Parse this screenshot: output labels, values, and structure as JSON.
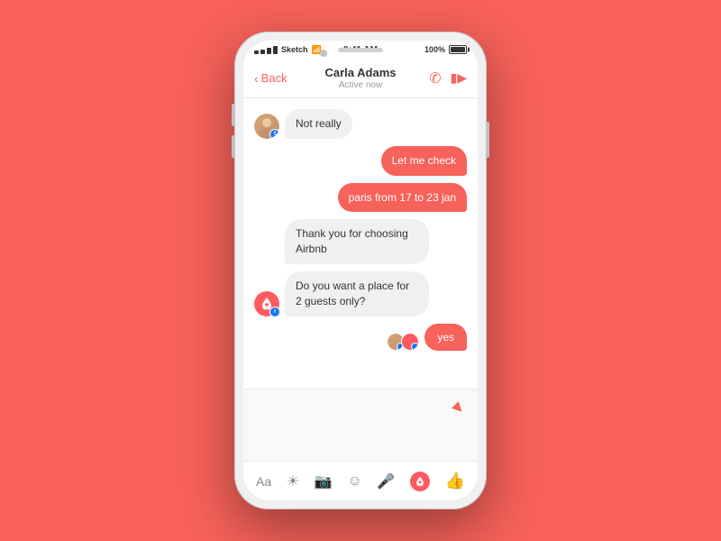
{
  "background_color": "#F7625A",
  "phone": {
    "status_bar": {
      "signal": "●●●●",
      "carrier": "Sketch",
      "wifi": "WiFi",
      "time": "9:41 AM",
      "battery_pct": "100%"
    },
    "nav": {
      "back_label": "Back",
      "contact_name": "Carla Adams",
      "contact_status": "Active now"
    },
    "messages": [
      {
        "id": "msg1",
        "type": "incoming",
        "avatar_type": "person",
        "text": "Not really",
        "has_fb_badge": true
      },
      {
        "id": "msg2",
        "type": "outgoing",
        "text": "Let me check"
      },
      {
        "id": "msg3",
        "type": "outgoing",
        "text": "paris from 17 to 23 jan"
      },
      {
        "id": "msg4",
        "type": "incoming",
        "avatar_type": "none",
        "text": "Thank you for choosing Airbnb"
      },
      {
        "id": "msg5",
        "type": "incoming",
        "avatar_type": "airbnb",
        "text": "Do you want a place for 2 guests only?",
        "has_fb_badge": true
      },
      {
        "id": "msg6",
        "type": "outgoing",
        "text": "yes",
        "show_avatars": true
      }
    ],
    "toolbar": {
      "aa_label": "Aa",
      "icons": [
        "camera",
        "photo",
        "emoji",
        "mic",
        "airbnb",
        "like"
      ]
    }
  }
}
